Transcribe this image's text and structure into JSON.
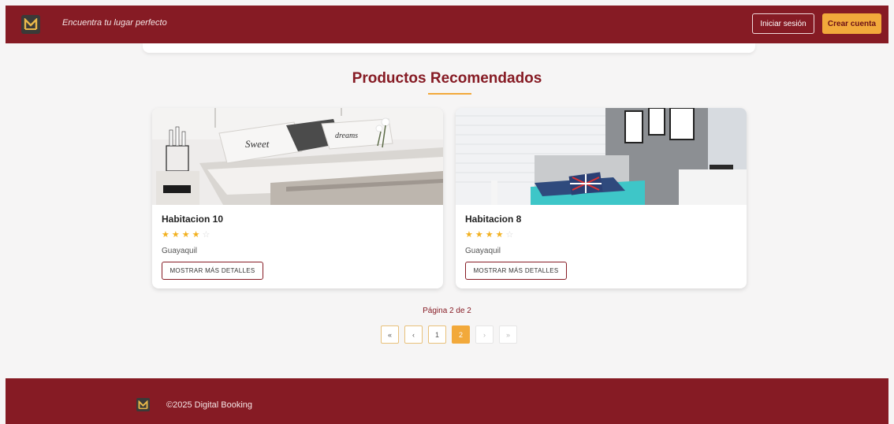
{
  "header": {
    "tagline": "Encuentra tu lugar perfecto",
    "login_label": "Iniciar sesión",
    "signup_label": "Crear cuenta"
  },
  "section": {
    "title": "Productos Recomendados"
  },
  "products": [
    {
      "title": "Habitacion 10",
      "rating": 4,
      "max_rating": 5,
      "city": "Guayaquil",
      "button": "MOSTRAR MÁS DETALLES"
    },
    {
      "title": "Habitacion 8",
      "rating": 4,
      "max_rating": 5,
      "city": "Guayaquil",
      "button": "MOSTRAR MÁS DETALLES"
    }
  ],
  "pagination": {
    "info": "Página 2 de 2",
    "first": "«",
    "prev": "‹",
    "pages": [
      "1",
      "2"
    ],
    "current": 2,
    "next": "›",
    "last": "»"
  },
  "footer": {
    "copyright": "©2025 Digital Booking"
  },
  "colors": {
    "brand": "#861b24",
    "accent": "#f2a93b",
    "star": "#f2b01e"
  }
}
